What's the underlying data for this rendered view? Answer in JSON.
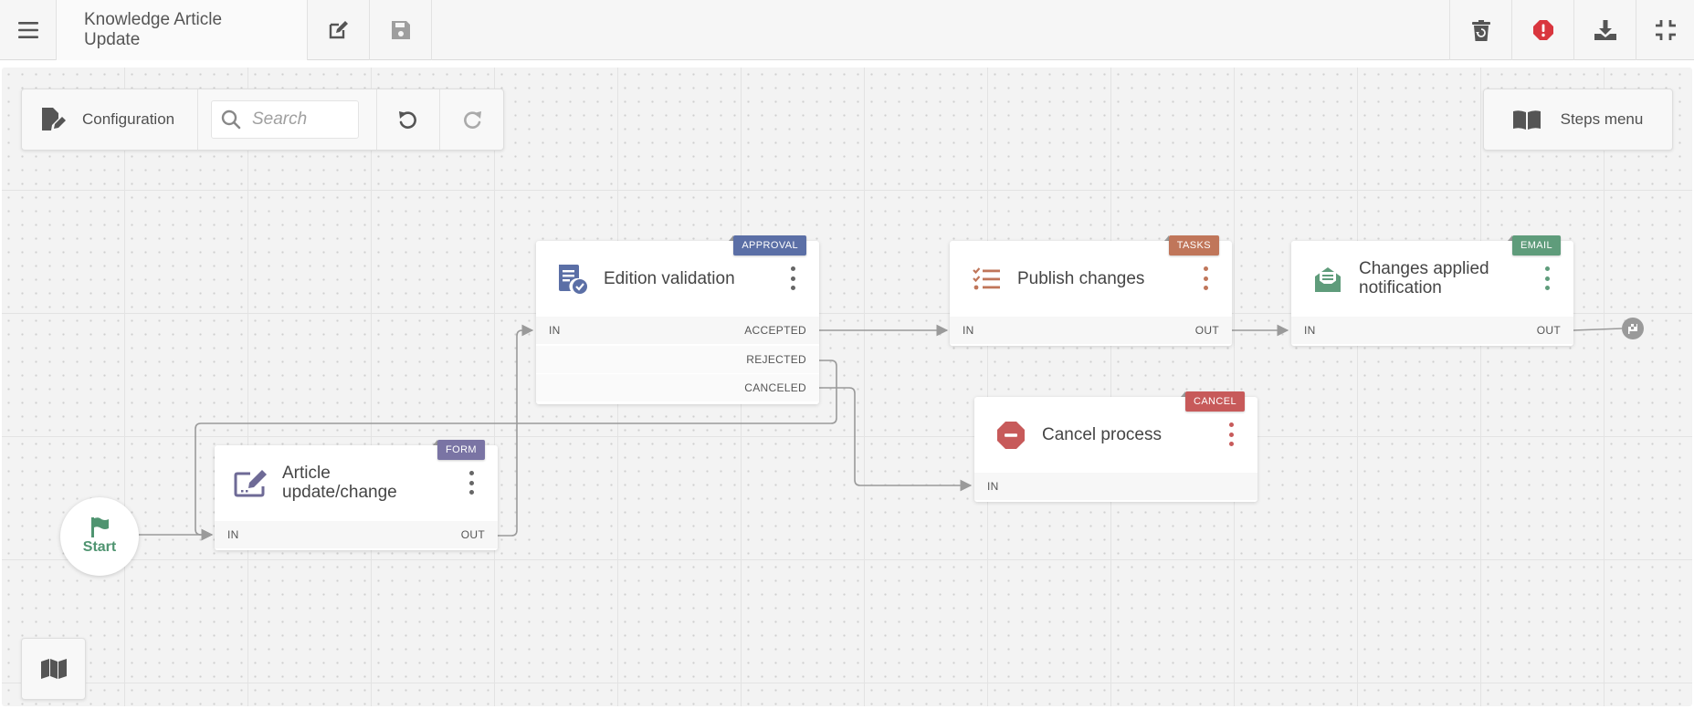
{
  "app": {
    "title": "Knowledge Article Update"
  },
  "toolbar": {
    "menu_icon": "hamburger-icon",
    "edit_icon": "edit-icon",
    "save_icon": "save-icon",
    "right_icons": [
      "trash-restore-icon",
      "alert-icon",
      "download-icon",
      "compress-icon"
    ],
    "alert_color": "#d9363e"
  },
  "config_panel": {
    "label": "Configuration",
    "search_placeholder": "Search",
    "undo_icon": "undo-icon",
    "redo_icon": "redo-icon"
  },
  "steps_menu": {
    "label": "Steps menu"
  },
  "start": {
    "label": "Start"
  },
  "steps": {
    "article": {
      "tag": "FORM",
      "title_line1": "Article",
      "title_line2": "update/change",
      "in": "IN",
      "out": "OUT",
      "color": "#7a74a4"
    },
    "validation": {
      "tag": "APPROVAL",
      "title": "Edition validation",
      "in": "IN",
      "outs": [
        "ACCEPTED",
        "REJECTED",
        "CANCELED"
      ],
      "color": "#5b6fa6"
    },
    "publish": {
      "tag": "TASKS",
      "title": "Publish changes",
      "in": "IN",
      "out": "OUT",
      "color": "#c0765a"
    },
    "notification": {
      "tag": "EMAIL",
      "title_line1": "Changes applied",
      "title_line2": "notification",
      "in": "IN",
      "out": "OUT",
      "color": "#5f9c7b"
    },
    "cancel": {
      "tag": "CANCEL",
      "title": "Cancel process",
      "in": "IN",
      "color": "#c75a5a"
    }
  },
  "colors": {
    "link": "#9a9a9a",
    "canvas": "#f3f3f3"
  }
}
